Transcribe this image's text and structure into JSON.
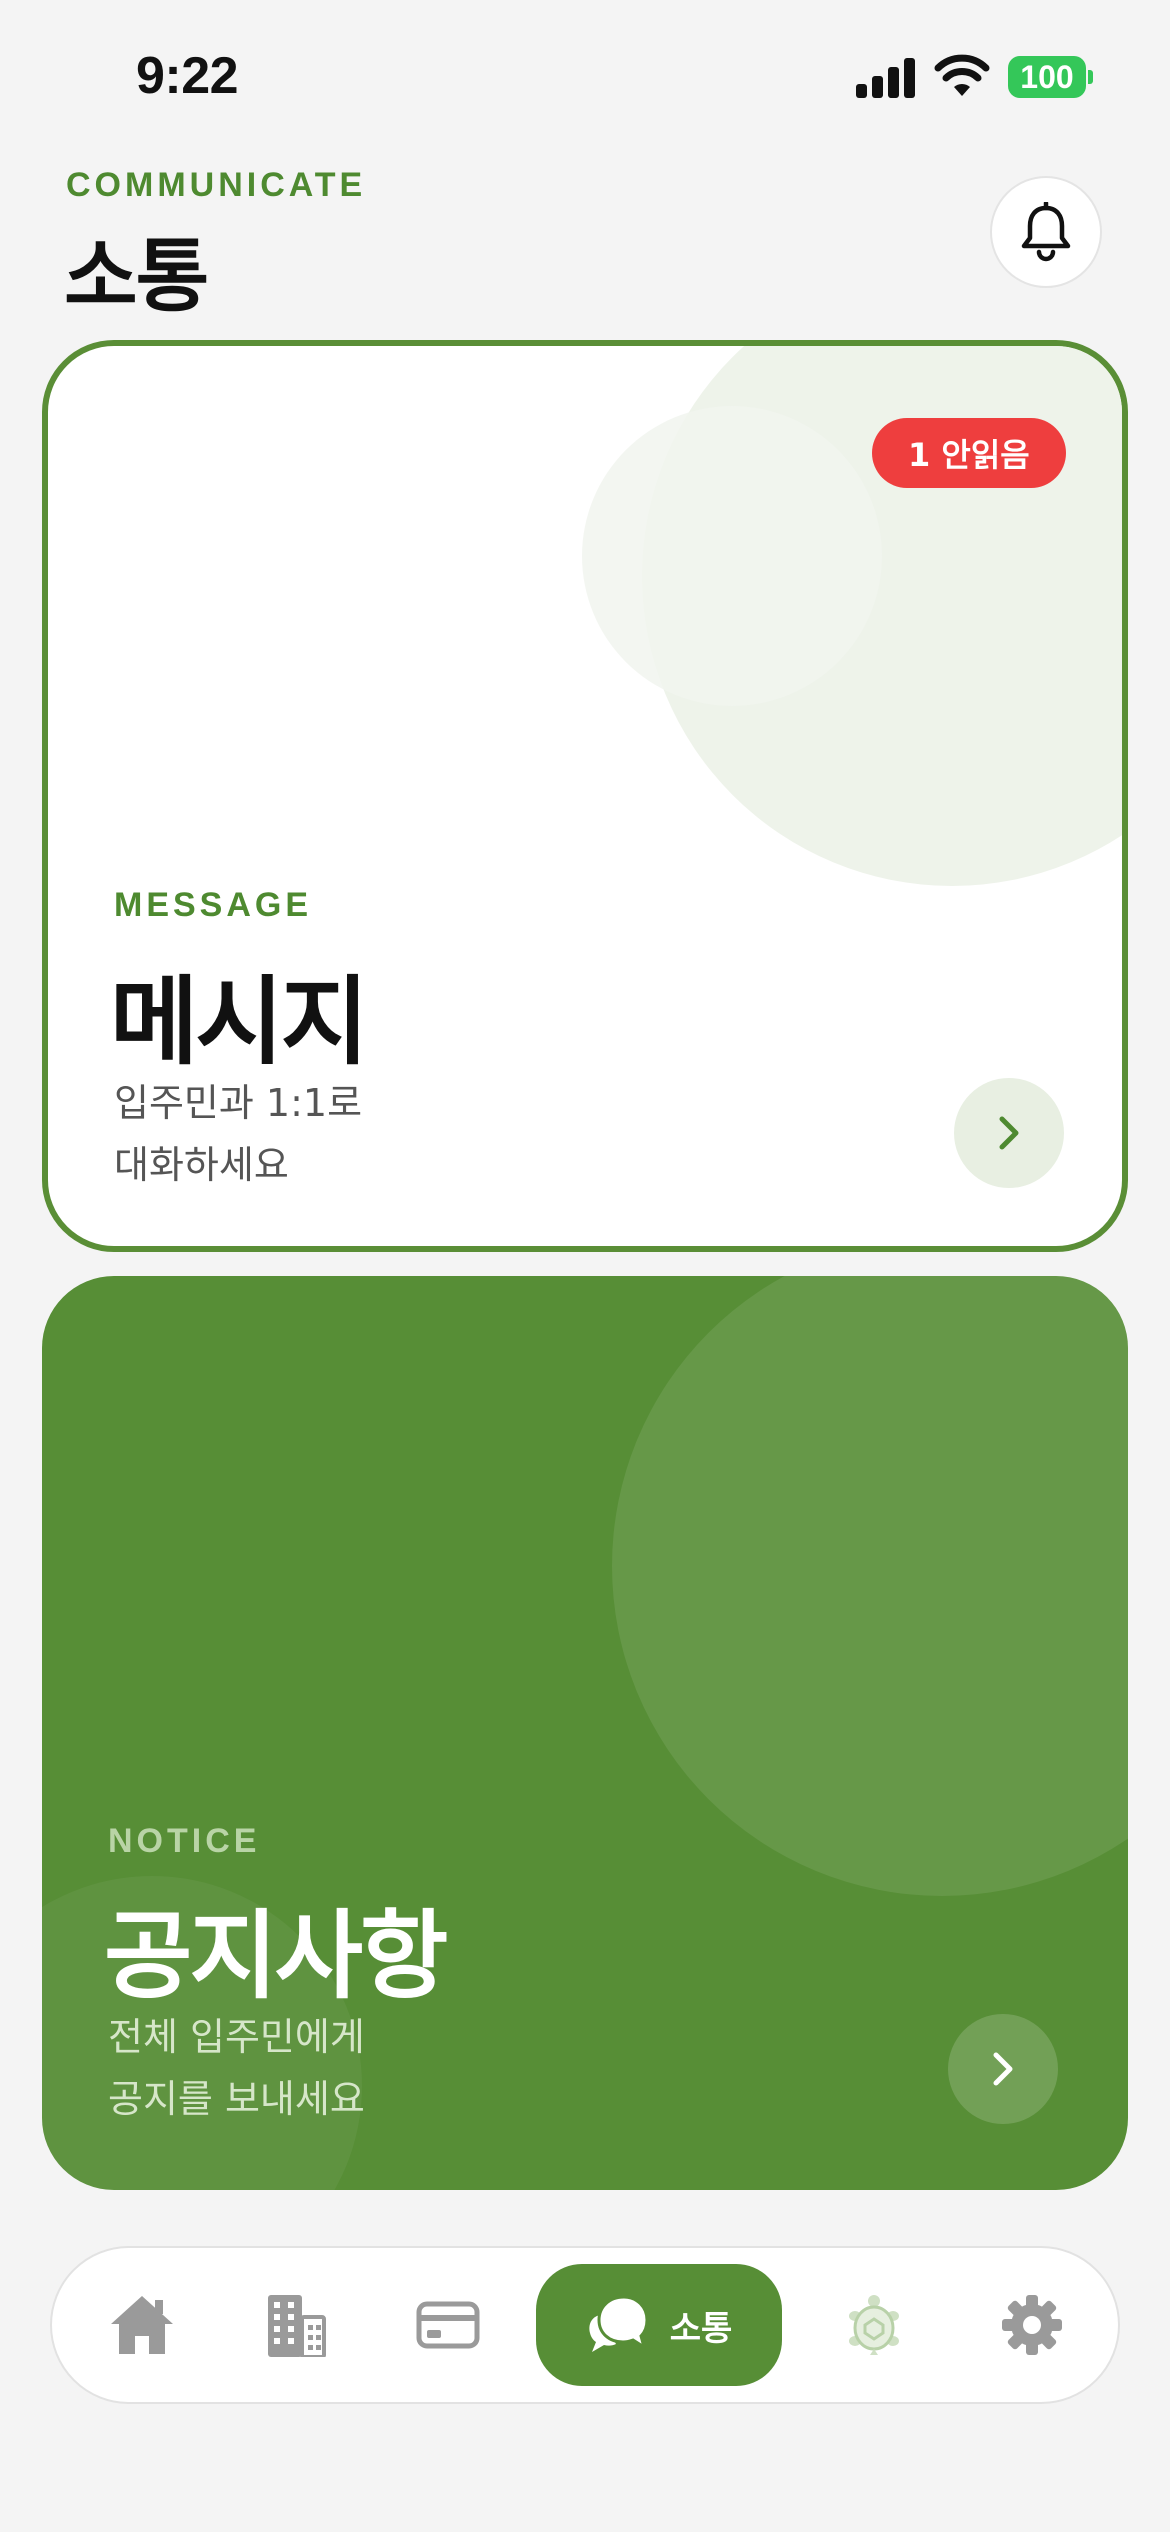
{
  "status_bar": {
    "time": "9:22",
    "battery": "100"
  },
  "header": {
    "eyebrow": "COMMUNICATE",
    "title": "소통"
  },
  "message_card": {
    "badge": "1 안읽음",
    "eyebrow": "MESSAGE",
    "title": "메시지",
    "desc_line1": "입주민과 1:1로",
    "desc_line2": "대화하세요"
  },
  "notice_card": {
    "eyebrow": "NOTICE",
    "title": "공지사항",
    "desc_line1": "전체 입주민에게",
    "desc_line2": "공지를 보내세요"
  },
  "tab_bar": {
    "active_label": "소통",
    "items": [
      "home-icon",
      "building-icon",
      "credit-card-icon",
      "chat-bubbles-icon",
      "turtle-icon",
      "gear-icon"
    ]
  },
  "colors": {
    "brand_green": "#578e36",
    "badge_red": "#ee3e3e",
    "battery_green": "#34c759"
  }
}
